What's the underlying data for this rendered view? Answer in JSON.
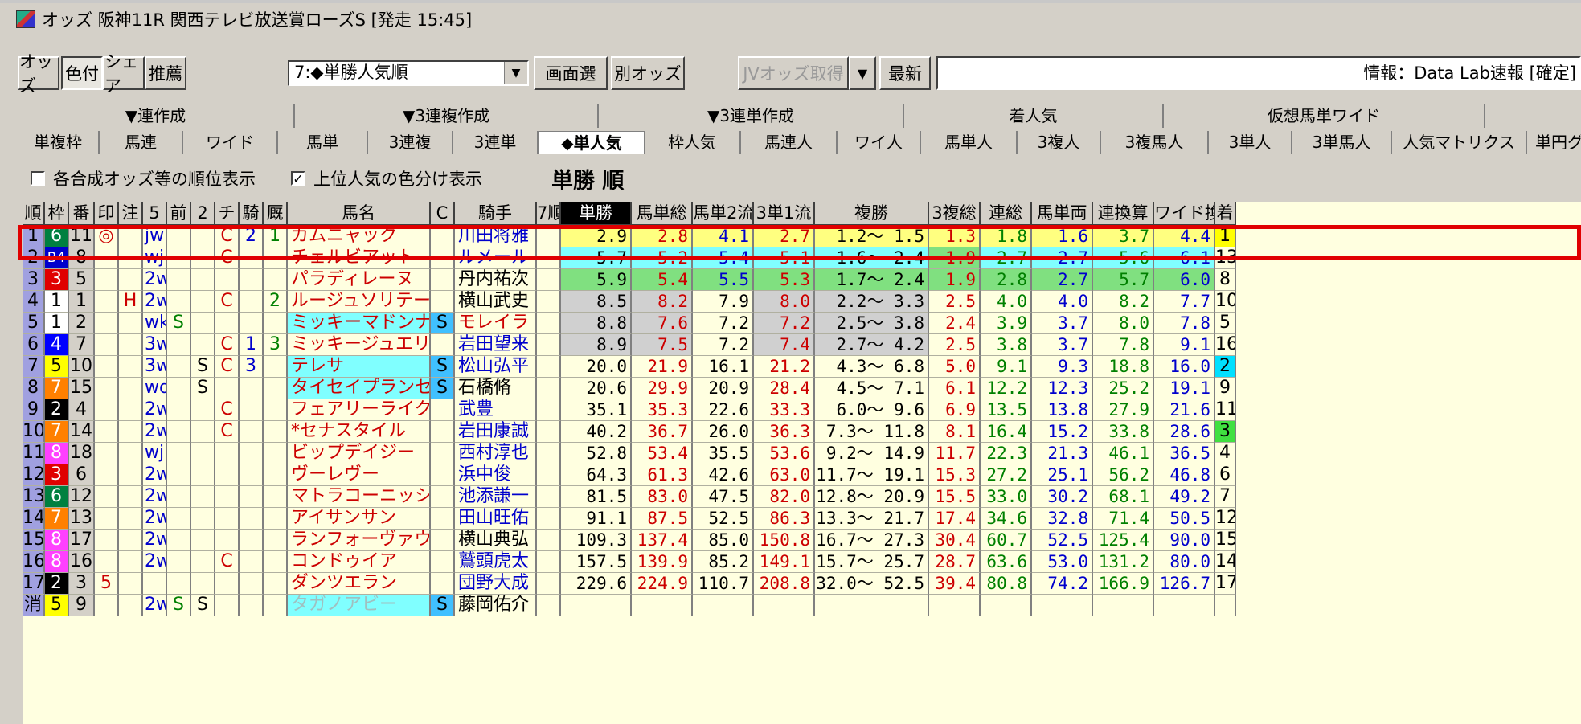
{
  "window": {
    "title": "オッズ 阪神11R 関西テレビ放送賞ローズS [発走 15:45]"
  },
  "toolbar": {
    "btn_odds": "オッズ",
    "btn_color": "色付",
    "btn_share": "シェア",
    "btn_recommend": "推薦",
    "sort_select": "7:◆単勝人気順",
    "btn_screen_select": "画面選",
    "btn_other_odds": "別オッズ",
    "btn_jv_fetch": "JVオッズ取得",
    "btn_latest": "最新",
    "info_text": "情報：Data Lab速報 [確定]"
  },
  "tabs_top": [
    "▼連作成",
    "▼3連複作成",
    "▼3連単作成",
    "着人気",
    "仮想馬単ワイド"
  ],
  "tabs_bottom": [
    "単複枠",
    "馬連",
    "ワイド",
    "馬単",
    "3連複",
    "3連単",
    "◆単人気",
    "枠人気",
    "馬連人",
    "ワイ人",
    "馬単人",
    "3複人",
    "3複馬人",
    "3単人",
    "3単馬人",
    "人気マトリクス",
    "単円グ"
  ],
  "options": {
    "rank_display": "各合成オッズ等の順位表示",
    "color_top": "上位人気の色分け表示",
    "rank_display_checked": false,
    "color_top_checked": true
  },
  "sort_title": "単勝 順",
  "columns": [
    "順",
    "枠",
    "番",
    "印",
    "注",
    "5",
    "前",
    "2",
    "チ",
    "騎",
    "厩",
    "馬名",
    "C",
    "騎手",
    "7順",
    "単勝",
    "馬単総",
    "馬単2流",
    "3単1流",
    "複勝",
    "3複総",
    "連総",
    "馬単両",
    "連換算",
    "ワイド換",
    "着"
  ],
  "frame_colors": {
    "1": "#ffffff",
    "2": "#000000",
    "3": "#e00000",
    "4": "#0000ff",
    "5": "#ffff00",
    "6": "#008040",
    "7": "#ff8000",
    "8": "#ff40ff",
    "B4": "#0000cc"
  },
  "rows": [
    {
      "rank": "1",
      "waku": "6",
      "ban": "11",
      "mark": "◎",
      "chu": "",
      "five": "jw",
      "mae": "",
      "two": "",
      "chi": "C",
      "ki": "2",
      "kyu": "1",
      "horse": "カムニャック",
      "c": "",
      "jockey": "川田将雅",
      "tan": "2.9",
      "umatan": "2.8",
      "ut2": "4.1",
      "s3": "2.7",
      "fuku_lo": "1.2",
      "fuku_hi": "1.5",
      "sanpuku": "1.3",
      "ren": "1.8",
      "ury": "1.6",
      "renk": "3.7",
      "wide": "4.4",
      "chaku": "1"
    },
    {
      "rank": "2",
      "waku": "B4",
      "ban": "8",
      "mark": "",
      "chu": "",
      "five": "wj",
      "mae": "",
      "two": "",
      "chi": "C",
      "ki": "",
      "kyu": "",
      "horse": "チェルビアット",
      "c": "",
      "jockey": "ルメール",
      "tan": "5.7",
      "umatan": "5.2",
      "ut2": "5.4",
      "s3": "5.1",
      "fuku_lo": "1.6",
      "fuku_hi": "2.4",
      "sanpuku": "1.9",
      "ren": "2.7",
      "ury": "2.7",
      "renk": "5.6",
      "wide": "6.1",
      "chaku": "13"
    },
    {
      "rank": "3",
      "waku": "3",
      "ban": "5",
      "mark": "",
      "chu": "",
      "five": "2w",
      "mae": "",
      "two": "",
      "chi": "",
      "ki": "",
      "kyu": "",
      "horse": "パラディレーヌ",
      "c": "",
      "jockey": "丹内祐次",
      "tan": "5.9",
      "umatan": "5.4",
      "ut2": "5.5",
      "s3": "5.3",
      "fuku_lo": "1.7",
      "fuku_hi": "2.4",
      "sanpuku": "1.9",
      "ren": "2.8",
      "ury": "2.7",
      "renk": "5.7",
      "wide": "6.0",
      "chaku": "8"
    },
    {
      "rank": "4",
      "waku": "1",
      "ban": "1",
      "mark": "",
      "chu": "H",
      "five": "2w",
      "mae": "",
      "two": "",
      "chi": "C",
      "ki": "",
      "kyu": "2",
      "horse": "ルージュソリテール",
      "c": "",
      "jockey": "横山武史",
      "tan": "8.5",
      "umatan": "8.2",
      "ut2": "7.9",
      "s3": "8.0",
      "fuku_lo": "2.2",
      "fuku_hi": "3.3",
      "sanpuku": "2.5",
      "ren": "4.0",
      "ury": "4.0",
      "renk": "8.2",
      "wide": "7.7",
      "chaku": "10"
    },
    {
      "rank": "5",
      "waku": "1",
      "ban": "2",
      "mark": "",
      "chu": "",
      "five": "wk",
      "mae": "S",
      "two": "",
      "chi": "",
      "ki": "",
      "kyu": "",
      "horse": "ミッキーマドンナ",
      "c": "S",
      "jockey": "モレイラ",
      "tan": "8.8",
      "umatan": "7.6",
      "ut2": "7.2",
      "s3": "7.2",
      "fuku_lo": "2.5",
      "fuku_hi": "3.8",
      "sanpuku": "2.4",
      "ren": "3.9",
      "ury": "3.7",
      "renk": "8.0",
      "wide": "7.8",
      "chaku": "5"
    },
    {
      "rank": "6",
      "waku": "4",
      "ban": "7",
      "mark": "",
      "chu": "",
      "five": "3w",
      "mae": "",
      "two": "",
      "chi": "C",
      "ki": "1",
      "kyu": "3",
      "horse": "ミッキージュエリー",
      "c": "",
      "jockey": "岩田望来",
      "tan": "8.9",
      "umatan": "7.5",
      "ut2": "7.2",
      "s3": "7.4",
      "fuku_lo": "2.7",
      "fuku_hi": "4.2",
      "sanpuku": "2.5",
      "ren": "3.8",
      "ury": "3.7",
      "renk": "7.8",
      "wide": "9.1",
      "chaku": "16"
    },
    {
      "rank": "7",
      "waku": "5",
      "ban": "10",
      "mark": "",
      "chu": "",
      "five": "3w",
      "mae": "",
      "two": "S",
      "chi": "C",
      "ki": "3",
      "kyu": "",
      "horse": "テレサ",
      "c": "S",
      "jockey": "松山弘平",
      "tan": "20.0",
      "umatan": "21.9",
      "ut2": "16.1",
      "s3": "21.2",
      "fuku_lo": "4.3",
      "fuku_hi": "6.8",
      "sanpuku": "5.0",
      "ren": "9.1",
      "ury": "9.3",
      "renk": "18.8",
      "wide": "16.0",
      "chaku": "2"
    },
    {
      "rank": "8",
      "waku": "7",
      "ban": "15",
      "mark": "",
      "chu": "",
      "five": "wd",
      "mae": "",
      "two": "S",
      "chi": "",
      "ki": "",
      "kyu": "",
      "horse": "タイセイプランセス",
      "c": "S",
      "jockey": "石橋脩",
      "tan": "20.6",
      "umatan": "29.9",
      "ut2": "20.9",
      "s3": "28.4",
      "fuku_lo": "4.5",
      "fuku_hi": "7.1",
      "sanpuku": "6.1",
      "ren": "12.2",
      "ury": "12.3",
      "renk": "25.2",
      "wide": "19.1",
      "chaku": "9"
    },
    {
      "rank": "9",
      "waku": "2",
      "ban": "4",
      "mark": "",
      "chu": "",
      "five": "2w",
      "mae": "",
      "two": "",
      "chi": "C",
      "ki": "",
      "kyu": "",
      "horse": "フェアリーライク",
      "c": "",
      "jockey": "武豊",
      "tan": "35.1",
      "umatan": "35.3",
      "ut2": "22.6",
      "s3": "33.3",
      "fuku_lo": "6.0",
      "fuku_hi": "9.6",
      "sanpuku": "6.9",
      "ren": "13.5",
      "ury": "13.8",
      "renk": "27.9",
      "wide": "21.6",
      "chaku": "11"
    },
    {
      "rank": "10",
      "waku": "7",
      "ban": "14",
      "mark": "",
      "chu": "",
      "five": "2w",
      "mae": "",
      "two": "",
      "chi": "C",
      "ki": "",
      "kyu": "",
      "horse": "*セナスタイル",
      "c": "",
      "jockey": "岩田康誠",
      "tan": "40.2",
      "umatan": "36.7",
      "ut2": "26.0",
      "s3": "36.3",
      "fuku_lo": "7.3",
      "fuku_hi": "11.8",
      "sanpuku": "8.1",
      "ren": "16.4",
      "ury": "15.2",
      "renk": "33.8",
      "wide": "28.6",
      "chaku": "3"
    },
    {
      "rank": "11",
      "waku": "8",
      "ban": "18",
      "mark": "",
      "chu": "",
      "five": "wj",
      "mae": "",
      "two": "",
      "chi": "",
      "ki": "",
      "kyu": "",
      "horse": "ビップデイジー",
      "c": "",
      "jockey": "西村淳也",
      "tan": "52.8",
      "umatan": "53.4",
      "ut2": "35.5",
      "s3": "53.6",
      "fuku_lo": "9.2",
      "fuku_hi": "14.9",
      "sanpuku": "11.7",
      "ren": "22.3",
      "ury": "21.3",
      "renk": "46.1",
      "wide": "36.5",
      "chaku": "4"
    },
    {
      "rank": "12",
      "waku": "3",
      "ban": "6",
      "mark": "",
      "chu": "",
      "five": "2w",
      "mae": "",
      "two": "",
      "chi": "",
      "ki": "",
      "kyu": "",
      "horse": "ヴーレヴー",
      "c": "",
      "jockey": "浜中俊",
      "tan": "64.3",
      "umatan": "61.3",
      "ut2": "42.6",
      "s3": "63.0",
      "fuku_lo": "11.7",
      "fuku_hi": "19.1",
      "sanpuku": "15.3",
      "ren": "27.2",
      "ury": "25.1",
      "renk": "56.2",
      "wide": "46.8",
      "chaku": "6"
    },
    {
      "rank": "13",
      "waku": "6",
      "ban": "12",
      "mark": "",
      "chu": "",
      "five": "2w",
      "mae": "",
      "two": "",
      "chi": "",
      "ki": "",
      "kyu": "",
      "horse": "マトラコーニッシュ",
      "c": "",
      "jockey": "池添謙一",
      "tan": "81.5",
      "umatan": "83.0",
      "ut2": "47.5",
      "s3": "82.0",
      "fuku_lo": "12.8",
      "fuku_hi": "20.9",
      "sanpuku": "15.5",
      "ren": "33.0",
      "ury": "30.2",
      "renk": "68.1",
      "wide": "49.2",
      "chaku": "7"
    },
    {
      "rank": "14",
      "waku": "7",
      "ban": "13",
      "mark": "",
      "chu": "",
      "five": "2w",
      "mae": "",
      "two": "",
      "chi": "",
      "ki": "",
      "kyu": "",
      "horse": "アイサンサン",
      "c": "",
      "jockey": "田山旺佑",
      "tan": "91.1",
      "umatan": "87.5",
      "ut2": "52.5",
      "s3": "86.3",
      "fuku_lo": "13.3",
      "fuku_hi": "21.7",
      "sanpuku": "17.4",
      "ren": "34.6",
      "ury": "32.8",
      "renk": "71.4",
      "wide": "50.5",
      "chaku": "12"
    },
    {
      "rank": "15",
      "waku": "8",
      "ban": "17",
      "mark": "",
      "chu": "",
      "five": "2w",
      "mae": "",
      "two": "",
      "chi": "",
      "ki": "",
      "kyu": "",
      "horse": "ランフォーヴァウ",
      "c": "",
      "jockey": "横山典弘",
      "tan": "109.3",
      "umatan": "137.4",
      "ut2": "85.0",
      "s3": "150.8",
      "fuku_lo": "16.7",
      "fuku_hi": "27.3",
      "sanpuku": "30.4",
      "ren": "60.7",
      "ury": "52.5",
      "renk": "125.4",
      "wide": "90.0",
      "chaku": "15"
    },
    {
      "rank": "16",
      "waku": "8",
      "ban": "16",
      "mark": "",
      "chu": "",
      "five": "2w",
      "mae": "",
      "two": "",
      "chi": "C",
      "ki": "",
      "kyu": "",
      "horse": "コンドゥイア",
      "c": "",
      "jockey": "鷲頭虎太",
      "tan": "157.5",
      "umatan": "139.9",
      "ut2": "85.2",
      "s3": "149.1",
      "fuku_lo": "15.7",
      "fuku_hi": "25.7",
      "sanpuku": "28.7",
      "ren": "63.6",
      "ury": "53.0",
      "renk": "131.2",
      "wide": "80.0",
      "chaku": "14"
    },
    {
      "rank": "17",
      "waku": "2",
      "ban": "3",
      "mark": "5",
      "chu": "",
      "five": "",
      "mae": "",
      "two": "",
      "chi": "",
      "ki": "",
      "kyu": "",
      "horse": "ダンツエラン",
      "c": "",
      "jockey": "団野大成",
      "tan": "229.6",
      "umatan": "224.9",
      "ut2": "110.7",
      "s3": "208.8",
      "fuku_lo": "32.0",
      "fuku_hi": "52.5",
      "sanpuku": "39.4",
      "ren": "80.8",
      "ury": "74.2",
      "renk": "166.9",
      "wide": "126.7",
      "chaku": "17"
    },
    {
      "rank": "消",
      "waku": "5",
      "ban": "9",
      "mark": "",
      "chu": "",
      "five": "2w",
      "mae": "S",
      "two": "S",
      "chi": "",
      "ki": "",
      "kyu": "",
      "horse": "タガノアビー",
      "c": "S",
      "jockey": "藤岡佑介",
      "tan": "",
      "umatan": "",
      "ut2": "",
      "s3": "",
      "fuku_lo": "",
      "fuku_hi": "",
      "sanpuku": "",
      "ren": "",
      "ury": "",
      "renk": "",
      "wide": "",
      "chaku": ""
    }
  ]
}
